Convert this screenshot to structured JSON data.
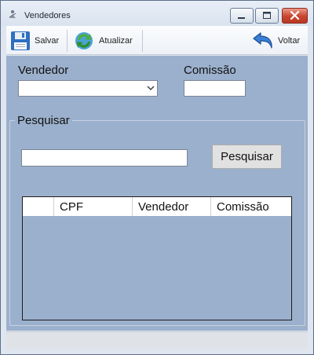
{
  "window": {
    "title": "Vendedores"
  },
  "toolbar": {
    "save_label": "Salvar",
    "refresh_label": "Atualizar",
    "back_label": "Voltar"
  },
  "form": {
    "vendedor_label": "Vendedor",
    "vendedor_value": "",
    "comissao_label": "Comissão",
    "comissao_value": ""
  },
  "search": {
    "group_label": "Pesquisar",
    "input_value": "",
    "button_label": "Pesquisar"
  },
  "grid": {
    "columns": [
      "CPF",
      "Vendedor",
      "Comissão"
    ],
    "rows": []
  },
  "colors": {
    "window_bg": "#dfe6ef",
    "panel_bg": "#9bb0cc",
    "close_red": "#c9442e"
  }
}
